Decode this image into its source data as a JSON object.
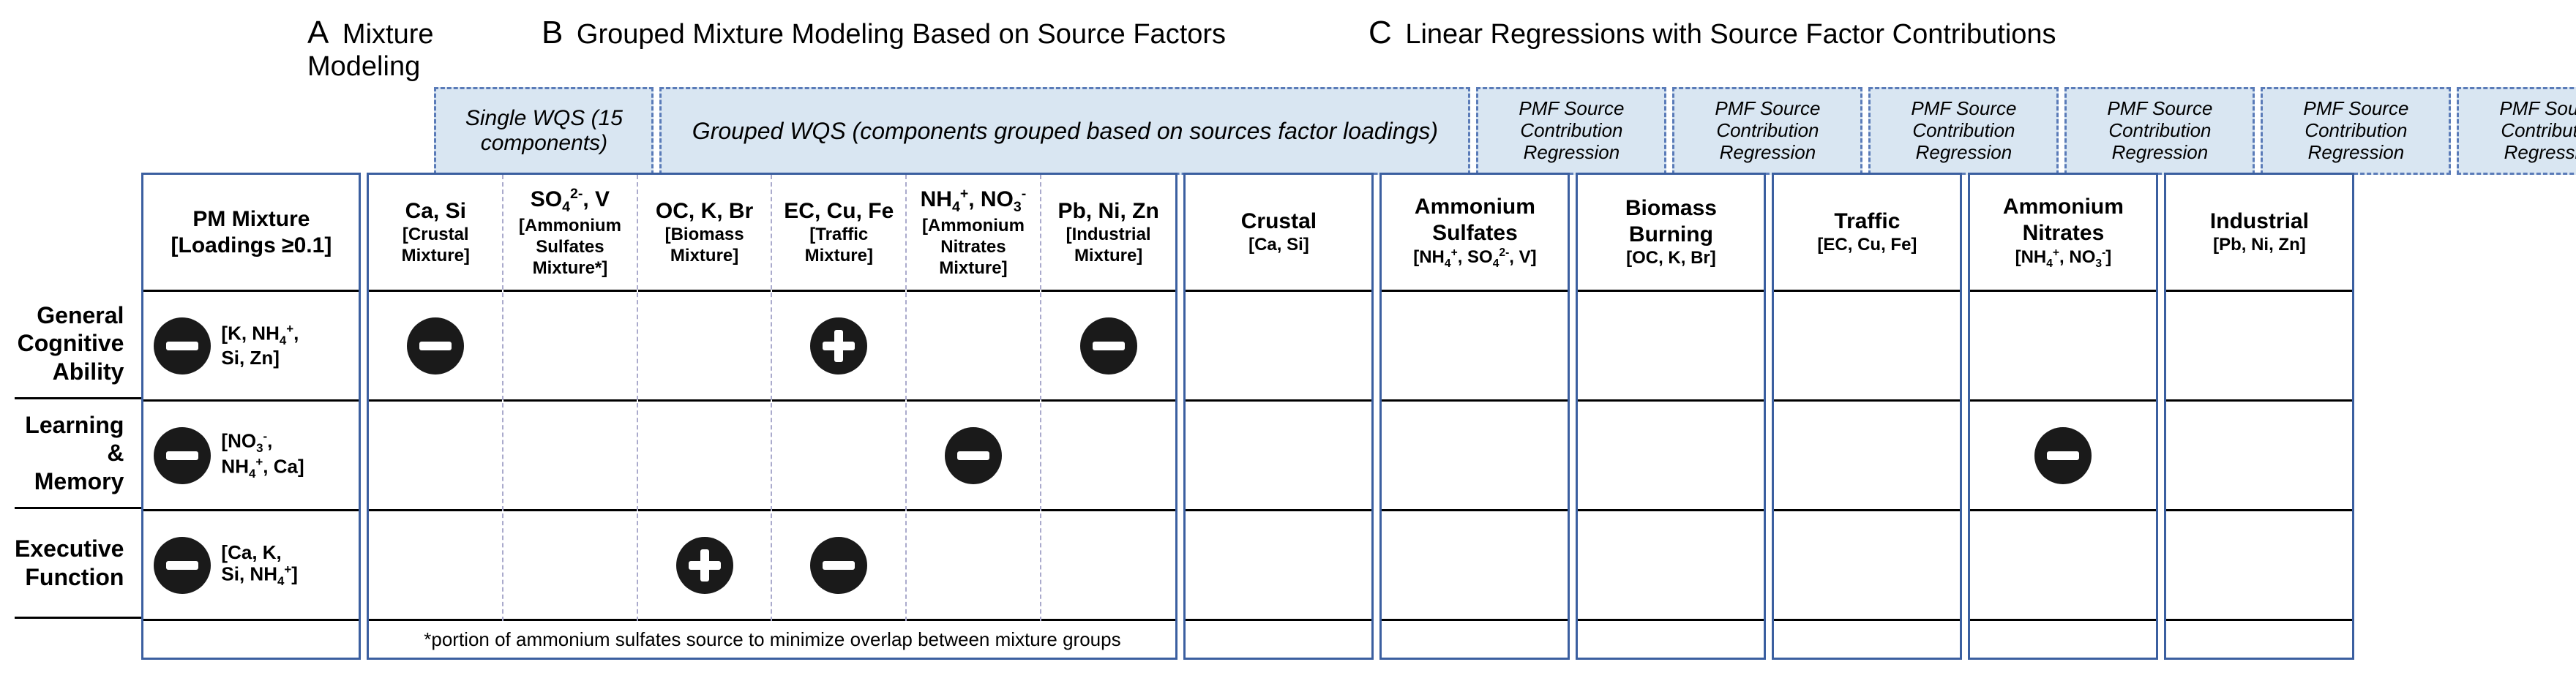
{
  "section_titles": {
    "a_letter": "A",
    "a": "Mixture Modeling",
    "b_letter": "B",
    "b": "Grouped Mixture Modeling Based on Source Factors",
    "c_letter": "C",
    "c": "Linear Regressions with Source Factor Contributions"
  },
  "dashed": {
    "a": "Single WQS (15 components)",
    "b": "Grouped WQS (components grouped based on sources factor loadings)",
    "c1": "PMF Source Contribution Regression",
    "c2": "PMF Source Contribution Regression",
    "c3": "PMF Source Contribution Regression",
    "c4": "PMF Source Contribution Regression",
    "c5": "PMF Source Contribution Regression",
    "c6": "PMF Source Contribution Regression"
  },
  "col_headers": {
    "a_bold": "PM Mixture",
    "a_sub": "[Loadings ≥0.1]",
    "b1_t": "Ca, Si",
    "b1_s": "[Crustal Mixture]",
    "b2_t": "SO₄²⁻, V",
    "b2_s": "[Ammonium Sulfates Mixture*]",
    "b3_t": "OC, K, Br",
    "b3_s": "[Biomass Mixture]",
    "b4_t": "EC, Cu, Fe",
    "b4_s": "[Traffic Mixture]",
    "b5_t": "NH₄⁺, NO₃⁻",
    "b5_s": "[Ammonium Nitrates Mixture]",
    "b6_t": "Pb, Ni, Zn",
    "b6_s": "[Industrial Mixture]",
    "c1_t": "Crustal",
    "c1_s": "[Ca, Si]",
    "c2_t": "Ammonium Sulfates",
    "c2_s": "[NH₄⁺, SO₄²⁻, V]",
    "c3_t": "Biomass Burning",
    "c3_s": "[OC, K, Br]",
    "c4_t": "Traffic",
    "c4_s": "[EC, Cu, Fe]",
    "c5_t": "Ammonium Nitrates",
    "c5_s": "[NH₄⁺, NO₃⁻]",
    "c6_t": "Industrial",
    "c6_s": "[Pb, Ni, Zn]"
  },
  "row_labels": {
    "r1": "General Cognitive Ability",
    "r2": "Learning & Memory",
    "r3": "Executive Function"
  },
  "pm_labels": {
    "r1": "[K, NH₄⁺, Si, Zn]",
    "r2": "[NO₃⁻, NH₄⁺, Ca]",
    "r3": "[Ca, K, Si, NH₄⁺]"
  },
  "footnote": "*portion of ammonium sulfates source to minimize overlap between mixture groups",
  "chart_data": {
    "type": "table",
    "rows": [
      "General Cognitive Ability",
      "Learning & Memory",
      "Executive Function"
    ],
    "columns_A": [
      "PM Mixture (Single WQS 15 components, Loadings ≥0.1)"
    ],
    "columns_B": [
      "Ca, Si [Crustal Mixture]",
      "SO4^2-, V [Ammonium Sulfates Mixture*]",
      "OC, K, Br [Biomass Mixture]",
      "EC, Cu, Fe [Traffic Mixture]",
      "NH4+, NO3- [Ammonium Nitrates Mixture]",
      "Pb, Ni, Zn [Industrial Mixture]"
    ],
    "columns_C": [
      "Crustal [Ca, Si]",
      "Ammonium Sulfates [NH4+, SO4^2-, V]",
      "Biomass Burning [OC, K, Br]",
      "Traffic [EC, Cu, Fe]",
      "Ammonium Nitrates [NH4+, NO3-]",
      "Industrial [Pb, Ni, Zn]"
    ],
    "pm_mixture_top_components": {
      "General Cognitive Ability": [
        "K",
        "NH4+",
        "Si",
        "Zn"
      ],
      "Learning & Memory": [
        "NO3-",
        "NH4+",
        "Ca"
      ],
      "Executive Function": [
        "Ca",
        "K",
        "Si",
        "NH4+"
      ]
    },
    "values_A": {
      "General Cognitive Ability": "negative",
      "Learning & Memory": "negative",
      "Executive Function": "negative"
    },
    "values_B": {
      "General Cognitive Ability": {
        "Ca, Si": "negative",
        "SO4^2-, V": null,
        "OC, K, Br": null,
        "EC, Cu, Fe": "positive",
        "NH4+, NO3-": null,
        "Pb, Ni, Zn": "negative"
      },
      "Learning & Memory": {
        "Ca, Si": null,
        "SO4^2-, V": null,
        "OC, K, Br": null,
        "EC, Cu, Fe": null,
        "NH4+, NO3-": "negative",
        "Pb, Ni, Zn": null
      },
      "Executive Function": {
        "Ca, Si": null,
        "SO4^2-, V": null,
        "OC, K, Br": "positive",
        "EC, Cu, Fe": "negative",
        "NH4+, NO3-": null,
        "Pb, Ni, Zn": null
      }
    },
    "values_C": {
      "General Cognitive Ability": {
        "Crustal": null,
        "Ammonium Sulfates": null,
        "Biomass Burning": null,
        "Traffic": null,
        "Ammonium Nitrates": null,
        "Industrial": null
      },
      "Learning & Memory": {
        "Crustal": null,
        "Ammonium Sulfates": null,
        "Biomass Burning": null,
        "Traffic": null,
        "Ammonium Nitrates": "negative",
        "Industrial": null
      },
      "Executive Function": {
        "Crustal": null,
        "Ammonium Sulfates": null,
        "Biomass Burning": null,
        "Traffic": null,
        "Ammonium Nitrates": null,
        "Industrial": null
      }
    },
    "legend": {
      "negative": "filled dark circle with minus sign",
      "positive": "filled dark circle with plus sign"
    },
    "footnote": "*portion of ammonium sulfates source to minimize overlap between mixture groups"
  }
}
